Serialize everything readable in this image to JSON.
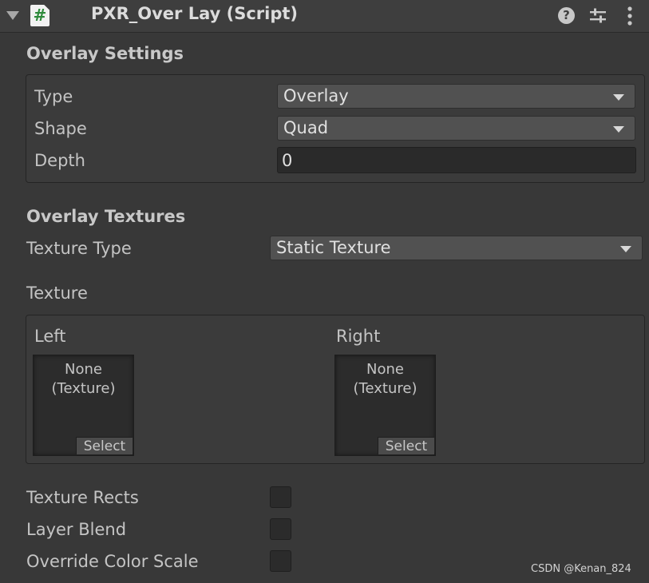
{
  "header": {
    "component_title": "PXR_Over Lay (Script)",
    "script_icon_glyph": "#",
    "icons": [
      "foldout-arrow-icon",
      "script-icon",
      "help-icon",
      "preset-icon",
      "kebab-menu-icon"
    ],
    "help_glyph": "?"
  },
  "overlay_settings": {
    "title": "Overlay Settings",
    "type_label": "Type",
    "type_value": "Overlay",
    "shape_label": "Shape",
    "shape_value": "Quad",
    "depth_label": "Depth",
    "depth_value": "0"
  },
  "overlay_textures": {
    "title": "Overlay Textures",
    "texture_type_label": "Texture Type",
    "texture_type_value": "Static Texture",
    "texture_label": "Texture",
    "left_label": "Left",
    "right_label": "Right",
    "slot_none_line1": "None",
    "slot_none_line2": "(Texture)",
    "select_label": "Select"
  },
  "options": {
    "texture_rects_label": "Texture Rects",
    "texture_rects_checked": false,
    "layer_blend_label": "Layer Blend",
    "layer_blend_checked": false,
    "override_color_scale_label": "Override Color Scale",
    "override_color_scale_checked": false
  },
  "watermark": "CSDN @Kenan_824",
  "colors": {
    "background": "#383838",
    "header": "#3e3e3e",
    "dropdown": "#515151",
    "field": "#2a2a2a",
    "script_icon_hash": "#2d8a3a"
  }
}
